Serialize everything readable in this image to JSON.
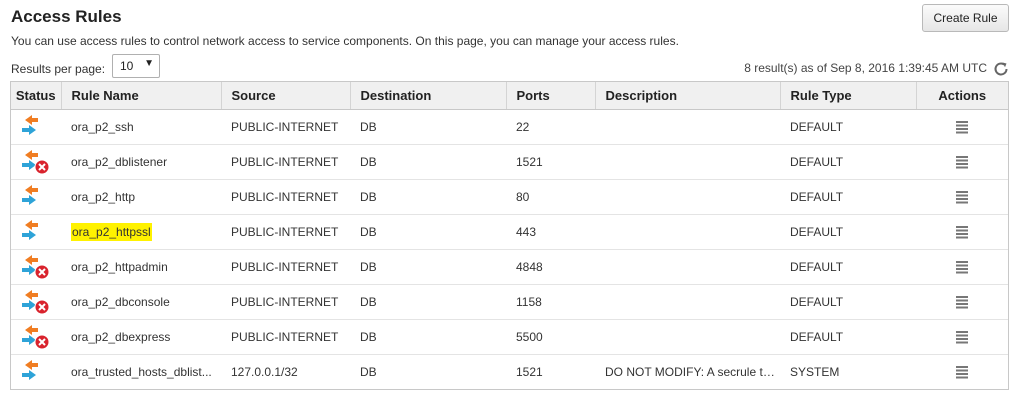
{
  "page": {
    "title": "Access Rules",
    "subtitle": "You can use access rules to control network access to service components. On this page, you can manage your access rules.",
    "create_button": "Create Rule"
  },
  "toolbar": {
    "results_per_page_label": "Results per page:",
    "results_per_page_value": "10",
    "results_info": "8 result(s) as of Sep 8, 2016 1:39:45 AM UTC",
    "refresh_icon": "refresh-icon"
  },
  "table": {
    "headers": [
      "Status",
      "Rule Name",
      "Source",
      "Destination",
      "Ports",
      "Description",
      "Rule Type",
      "Actions"
    ],
    "rows": [
      {
        "status": "enabled",
        "name": "ora_p2_ssh",
        "source": "PUBLIC-INTERNET",
        "destination": "DB",
        "ports": "22",
        "description": "",
        "type": "DEFAULT",
        "highlighted": false
      },
      {
        "status": "disabled",
        "name": "ora_p2_dblistener",
        "source": "PUBLIC-INTERNET",
        "destination": "DB",
        "ports": "1521",
        "description": "",
        "type": "DEFAULT",
        "highlighted": false
      },
      {
        "status": "enabled",
        "name": "ora_p2_http",
        "source": "PUBLIC-INTERNET",
        "destination": "DB",
        "ports": "80",
        "description": "",
        "type": "DEFAULT",
        "highlighted": false
      },
      {
        "status": "enabled",
        "name": "ora_p2_httpssl",
        "source": "PUBLIC-INTERNET",
        "destination": "DB",
        "ports": "443",
        "description": "",
        "type": "DEFAULT",
        "highlighted": true
      },
      {
        "status": "disabled",
        "name": "ora_p2_httpadmin",
        "source": "PUBLIC-INTERNET",
        "destination": "DB",
        "ports": "4848",
        "description": "",
        "type": "DEFAULT",
        "highlighted": false
      },
      {
        "status": "disabled",
        "name": "ora_p2_dbconsole",
        "source": "PUBLIC-INTERNET",
        "destination": "DB",
        "ports": "1158",
        "description": "",
        "type": "DEFAULT",
        "highlighted": false
      },
      {
        "status": "disabled",
        "name": "ora_p2_dbexpress",
        "source": "PUBLIC-INTERNET",
        "destination": "DB",
        "ports": "5500",
        "description": "",
        "type": "DEFAULT",
        "highlighted": false
      },
      {
        "status": "enabled",
        "name": "ora_trusted_hosts_dblist...",
        "source": "127.0.0.1/32",
        "destination": "DB",
        "ports": "1521",
        "description": "DO NOT MODIFY: A secrule to ...",
        "type": "SYSTEM",
        "highlighted": false
      }
    ]
  },
  "icons": {
    "status_enabled": "arrows-exchange-icon",
    "status_disabled": "arrows-exchange-disabled-icon",
    "actions": "hamburger-menu-icon"
  },
  "colors": {
    "arrow_in": "#2ea3d8",
    "arrow_out": "#f07d22",
    "disabled_badge": "#d9232d",
    "highlight": "#fff200",
    "header_bg": "#f0f0f0"
  }
}
